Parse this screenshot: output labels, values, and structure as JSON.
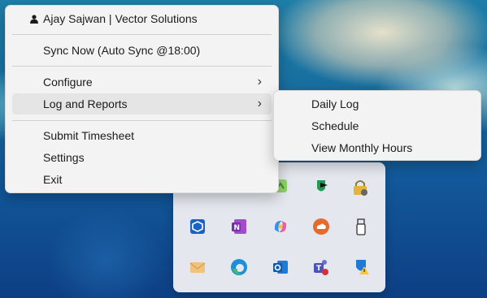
{
  "menu": {
    "user_label": "Ajay Sajwan | Vector Solutions",
    "sync_label": "Sync Now (Auto Sync @18:00)",
    "configure_label": "Configure",
    "log_reports_label": "Log and Reports",
    "submit_label": "Submit Timesheet",
    "settings_label": "Settings",
    "exit_label": "Exit",
    "chevron": "›"
  },
  "submenu": {
    "items": [
      "Daily Log",
      "Schedule",
      "View Monthly Hours"
    ]
  },
  "tray": {
    "icons": [
      "green-app-icon",
      "shield-flag-icon",
      "lock-icon",
      "blue-cube-icon",
      "onenote-icon",
      "copilot-icon",
      "cloud-sync-icon",
      "usb-drive-icon",
      "mail-icon",
      "edge-icon",
      "outlook-icon",
      "teams-icon",
      "shield-warning-icon"
    ]
  }
}
